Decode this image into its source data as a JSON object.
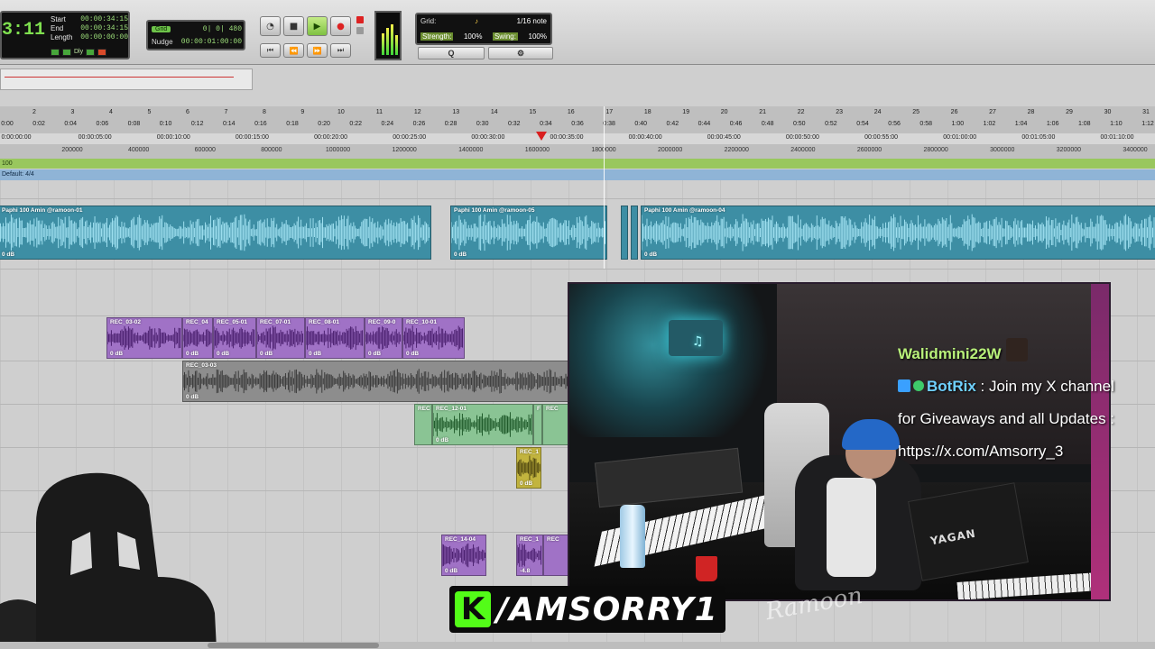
{
  "counter": {
    "main": "3:11",
    "start_label": "Start",
    "start": "00:00:34:15",
    "end_label": "End",
    "end": "00:00:34:15",
    "length_label": "Length",
    "length": "00:00:00:00",
    "dly": "Dly"
  },
  "grid_nudge": {
    "grid_label": "Grid",
    "grid_value": "0| 0| 480",
    "nudge_label": "Nudge",
    "nudge_value": "00:00:01:00:00"
  },
  "quantize": {
    "grid_label": "Grid:",
    "grid_value": "1/16 note",
    "strength_label": "Strength:",
    "strength_value": "100%",
    "swing_label": "Swing:",
    "swing_value": "100%",
    "q_button": "Q",
    "settings_icon": "gear-icon"
  },
  "rulers": {
    "bars": [
      "2",
      "3",
      "4",
      "5",
      "6",
      "7",
      "8",
      "9",
      "10",
      "11",
      "12",
      "13",
      "14",
      "15",
      "16",
      "17",
      "18",
      "19",
      "20",
      "21",
      "22",
      "23",
      "24",
      "25",
      "26",
      "27",
      "28",
      "29",
      "30",
      "31"
    ],
    "minsecs": [
      "0:00",
      "0:02",
      "0:04",
      "0:06",
      "0:08",
      "0:10",
      "0:12",
      "0:14",
      "0:16",
      "0:18",
      "0:20",
      "0:22",
      "0:24",
      "0:26",
      "0:28",
      "0:30",
      "0:32",
      "0:34",
      "0:36",
      "0:38",
      "0:40",
      "0:42",
      "0:44",
      "0:46",
      "0:48",
      "0:50",
      "0:52",
      "0:54",
      "0:56",
      "0:58",
      "1:00",
      "1:02",
      "1:04",
      "1:06",
      "1:08",
      "1:10",
      "1:12"
    ],
    "timecode": [
      "0:00:00:00",
      "00:00:05:00",
      "00:00:10:00",
      "00:00:15:00",
      "00:00:20:00",
      "00:00:25:00",
      "00:00:30:00",
      "00:00:35:00",
      "00:00:40:00",
      "00:00:45:00",
      "00:00:50:00",
      "00:00:55:00",
      "00:01:00:00",
      "00:01:05:00",
      "00:01:10:00"
    ],
    "samples": [
      "200000",
      "400000",
      "600000",
      "800000",
      "1000000",
      "1200000",
      "1400000",
      "1600000",
      "1800000",
      "2000000",
      "2200000",
      "2400000",
      "2600000",
      "2800000",
      "3000000",
      "3200000",
      "3400000"
    ],
    "tempo": "100",
    "meter": "Default: 4/4"
  },
  "clips": {
    "beat": [
      {
        "name": "Paphi 100 Amin @ramoon-01",
        "gain": "0 dB"
      },
      {
        "name": "Paphi 100 Amin @ramoon-05",
        "gain": "0 dB"
      },
      {
        "name": "Paphi 100 Amin @ramoon-04",
        "gain": "0 dB"
      }
    ],
    "vocal_row1": [
      {
        "name": "REC_03-02",
        "gain": "0 dB"
      },
      {
        "name": "REC_04",
        "gain": "0 dB"
      },
      {
        "name": "REC_05-01",
        "gain": "0 dB"
      },
      {
        "name": "REC_07-01",
        "gain": "0 dB"
      },
      {
        "name": "REC_08-01",
        "gain": "0 dB"
      },
      {
        "name": "REC_09-0",
        "gain": "0 dB"
      },
      {
        "name": "REC_10-01",
        "gain": "0 dB"
      }
    ],
    "vocal_row2": {
      "name": "REC_03-03",
      "gain": "0 dB"
    },
    "vocal_row3": [
      {
        "name": "REC",
        "gain": ""
      },
      {
        "name": "REC_12-01",
        "gain": "0 dB"
      },
      {
        "name": "F",
        "gain": ""
      },
      {
        "name": "REC",
        "gain": ""
      }
    ],
    "vocal_row4": {
      "name": "REC_1",
      "gain": "0 dB"
    },
    "vocal_row5": [
      {
        "name": "REC_14-04",
        "gain": "0 dB"
      },
      {
        "name": "REC_1",
        "gain": "-4.8"
      },
      {
        "name": "REC",
        "gain": ""
      }
    ]
  },
  "chat": {
    "msg1_user": "Walidmini22W",
    "msg1_sep": " :",
    "msg2_user": "BotRix",
    "msg2_text": " : Join my X channel for Giveaways and all Updates : https://x.com/Amsorry_3"
  },
  "overlay": {
    "kick_logo": "K",
    "handle": "/AMSORRY1",
    "signature": "Ramoon",
    "neon_sign": "♫",
    "amp_brand": "YAGAN"
  },
  "colors": {
    "beat_clip": "#3d8ea4",
    "vocal_purple": "#a072c6",
    "vocal_gray": "#8d8d8d",
    "vocal_green": "#8ac494",
    "vocal_yellow": "#c2b43e",
    "kick_green": "#53fc18",
    "chat_user": "#b8f07a"
  }
}
